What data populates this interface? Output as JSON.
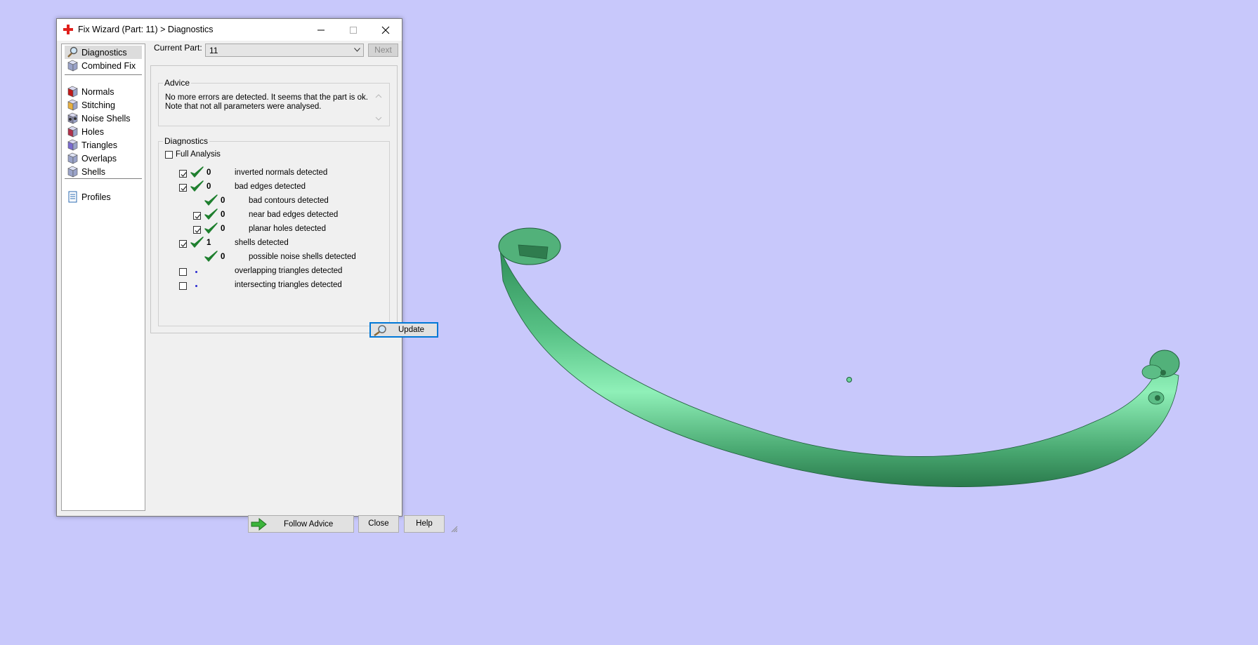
{
  "window": {
    "title": "Fix Wizard (Part: 11) > Diagnostics",
    "app_icon": "red-cross-icon",
    "controls": [
      "minimize-icon",
      "maximize-icon",
      "close-icon"
    ]
  },
  "sidebar": {
    "groups": [
      [
        {
          "label": "Diagnostics",
          "icon": "magnifier-icon",
          "selected": true
        },
        {
          "label": "Combined Fix",
          "icon": "cube-icon",
          "selected": false
        }
      ],
      [
        {
          "label": "Normals",
          "icon": "normals-icon"
        },
        {
          "label": "Stitching",
          "icon": "stitching-icon"
        },
        {
          "label": "Noise Shells",
          "icon": "noise-shells-icon"
        },
        {
          "label": "Holes",
          "icon": "holes-icon"
        },
        {
          "label": "Triangles",
          "icon": "triangles-icon"
        },
        {
          "label": "Overlaps",
          "icon": "overlaps-icon"
        },
        {
          "label": "Shells",
          "icon": "shells-icon"
        }
      ],
      [
        {
          "label": "Profiles",
          "icon": "document-icon"
        }
      ]
    ]
  },
  "current_part": {
    "label": "Current Part:",
    "value": "11",
    "next_label": "Next"
  },
  "advice": {
    "title": "Advice",
    "text": "No more errors are detected. It seems that the part is ok. Note that not all parameters were analysed."
  },
  "diagnostics": {
    "title": "Diagnostics",
    "full_analysis_label": "Full Analysis",
    "full_analysis_checked": false,
    "rows": [
      {
        "checkbox": true,
        "checked": true,
        "indent": 0,
        "status": "ok",
        "count": "0",
        "label": "inverted normals detected"
      },
      {
        "checkbox": true,
        "checked": true,
        "indent": 0,
        "status": "ok",
        "count": "0",
        "label": "bad edges detected"
      },
      {
        "checkbox": false,
        "checked": false,
        "indent": 1,
        "status": "ok",
        "count": "0",
        "label": "bad contours detected"
      },
      {
        "checkbox": true,
        "checked": true,
        "indent": 1,
        "status": "ok",
        "count": "0",
        "label": "near bad edges detected"
      },
      {
        "checkbox": true,
        "checked": true,
        "indent": 1,
        "status": "ok",
        "count": "0",
        "label": "planar holes detected"
      },
      {
        "checkbox": true,
        "checked": true,
        "indent": 0,
        "status": "ok",
        "count": "1",
        "label": "shells detected"
      },
      {
        "checkbox": false,
        "checked": false,
        "indent": 1,
        "status": "ok",
        "count": "0",
        "label": "possible noise shells detected"
      },
      {
        "checkbox": true,
        "checked": false,
        "indent": 0,
        "status": "pending",
        "count": "",
        "label": "overlapping triangles detected"
      },
      {
        "checkbox": true,
        "checked": false,
        "indent": 0,
        "status": "pending",
        "count": "",
        "label": "intersecting triangles detected"
      }
    ],
    "update_label": "Update"
  },
  "footer": {
    "follow_label": "Follow Advice",
    "close_label": "Close",
    "help_label": "Help"
  },
  "colors": {
    "background": "#c8c8fb",
    "model": "#6dd39b",
    "check": "#1e7f2e"
  }
}
